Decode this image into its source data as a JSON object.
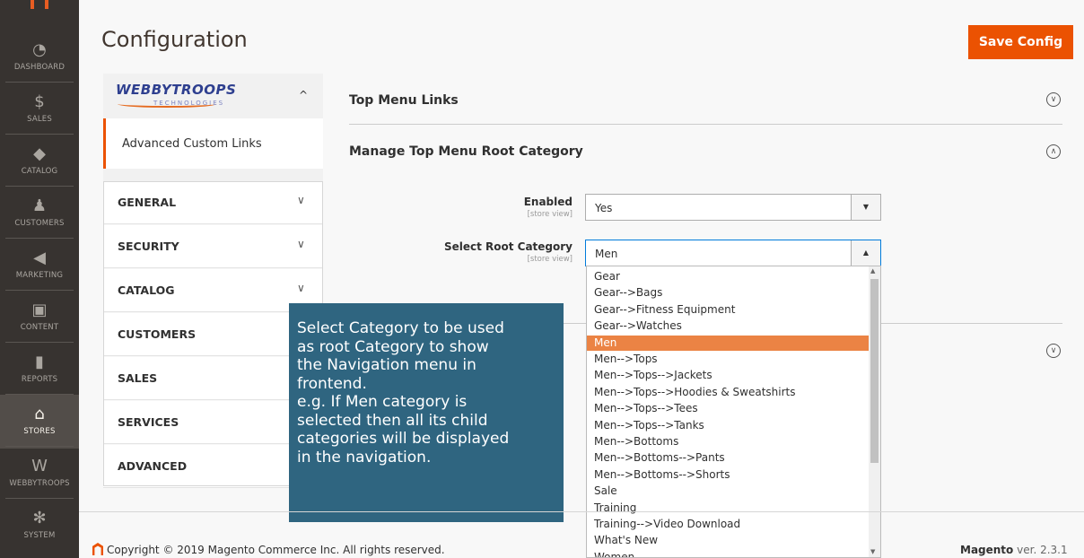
{
  "page": {
    "title": "Configuration",
    "save_label": "Save Config"
  },
  "adminbar": {
    "items": [
      {
        "label": "DASHBOARD",
        "icon": "dashboard-icon",
        "glyph": "◔"
      },
      {
        "label": "SALES",
        "icon": "dollar-icon",
        "glyph": "$"
      },
      {
        "label": "CATALOG",
        "icon": "cube-icon",
        "glyph": "◆"
      },
      {
        "label": "CUSTOMERS",
        "icon": "person-icon",
        "glyph": "♟"
      },
      {
        "label": "MARKETING",
        "icon": "megaphone-icon",
        "glyph": "◀"
      },
      {
        "label": "CONTENT",
        "icon": "layout-icon",
        "glyph": "▣"
      },
      {
        "label": "REPORTS",
        "icon": "bar-chart-icon",
        "glyph": "▮"
      },
      {
        "label": "STORES",
        "icon": "store-icon",
        "glyph": "⌂"
      },
      {
        "label": "WEBBYTROOPS",
        "icon": "webbytroops-icon",
        "glyph": "W"
      },
      {
        "label": "SYSTEM",
        "icon": "gear-icon",
        "glyph": "✻"
      }
    ]
  },
  "tabs": {
    "vendor": {
      "logo_text": "WEBBYTROOPS",
      "logo_subtext": "TECHNOLOGIES",
      "caret": "^"
    },
    "vendor_sub": "Advanced Custom Links",
    "items": [
      "GENERAL",
      "SECURITY",
      "CATALOG",
      "CUSTOMERS",
      "SALES",
      "SERVICES",
      "ADVANCED"
    ]
  },
  "main": {
    "section1_title": "Top Menu Links",
    "section2_title": "Manage Top Menu Root Category",
    "enabled": {
      "label": "Enabled",
      "scope": "[store view]",
      "value": "Yes"
    },
    "root_category": {
      "label": "Select Root Category",
      "scope": "[store view]",
      "value": "Men"
    }
  },
  "dropdown": {
    "options": [
      "Gear",
      "Gear-->Bags",
      "Gear-->Fitness Equipment",
      "Gear-->Watches",
      "Men",
      "Men-->Tops",
      "Men-->Tops-->Jackets",
      "Men-->Tops-->Hoodies & Sweatshirts",
      "Men-->Tops-->Tees",
      "Men-->Tops-->Tanks",
      "Men-->Bottoms",
      "Men-->Bottoms-->Pants",
      "Men-->Bottoms-->Shorts",
      "Sale",
      "Training",
      "Training-->Video Download",
      "What's New",
      "Women"
    ],
    "selected_index": 4
  },
  "tooltip": {
    "lines": [
      "Select Category to be used",
      "as root Category to show",
      "the Navigation menu in",
      "frontend.",
      "e.g. If Men category is",
      "selected then all its child",
      "categories will be displayed",
      "in the navigation."
    ]
  },
  "footer": {
    "copyright": "Copyright © 2019 Magento Commerce Inc. All rights reserved.",
    "brand": "Magento",
    "version": "ver. 2.3.1"
  },
  "colors": {
    "accent": "#eb5202",
    "adminbar": "#373330",
    "tooltip_bg": "#2f6580",
    "selected_option": "#eb8344"
  }
}
